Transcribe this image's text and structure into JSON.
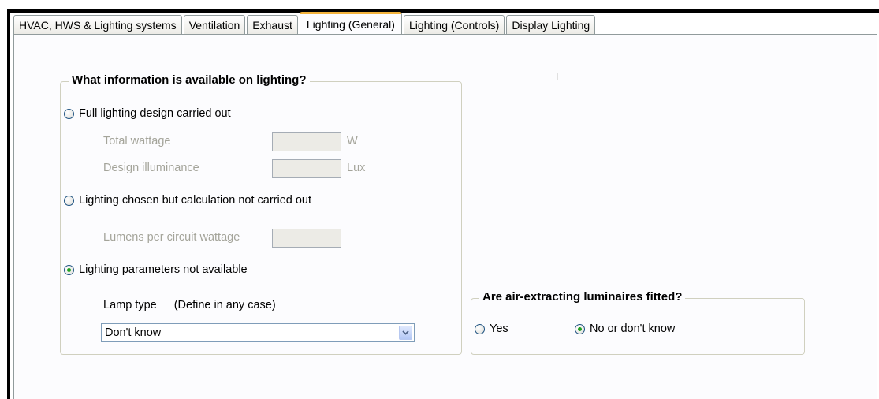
{
  "tabs": [
    {
      "label": "HVAC, HWS & Lighting systems",
      "active": false
    },
    {
      "label": "Ventilation",
      "active": false
    },
    {
      "label": "Exhaust",
      "active": false
    },
    {
      "label": "Lighting (General)",
      "active": true
    },
    {
      "label": "Lighting (Controls)",
      "active": false
    },
    {
      "label": "Display Lighting",
      "active": false
    }
  ],
  "lighting_info": {
    "title": "What information is available on lighting?",
    "option_full": "Full lighting design carried out",
    "total_wattage_label": "Total wattage",
    "total_wattage_value": "",
    "total_wattage_unit": "W",
    "design_illuminance_label": "Design illuminance",
    "design_illuminance_value": "",
    "design_illuminance_unit": "Lux",
    "option_chosen": "Lighting chosen but calculation not carried out",
    "lumens_label": "Lumens per circuit wattage",
    "lumens_value": "",
    "option_not_available": "Lighting parameters not available",
    "selected_option": "option_not_available",
    "lamp_type_label": "Lamp type",
    "lamp_type_hint": "(Define in any case)",
    "lamp_type_value": "Don't know"
  },
  "air_extract": {
    "title": "Are air-extracting luminaires fitted?",
    "option_yes": "Yes",
    "option_no": "No or don't know",
    "selected_option": "option_no"
  },
  "colors": {
    "active_tab_accent": "#f3b33c",
    "radio_dot": "#21a121"
  }
}
